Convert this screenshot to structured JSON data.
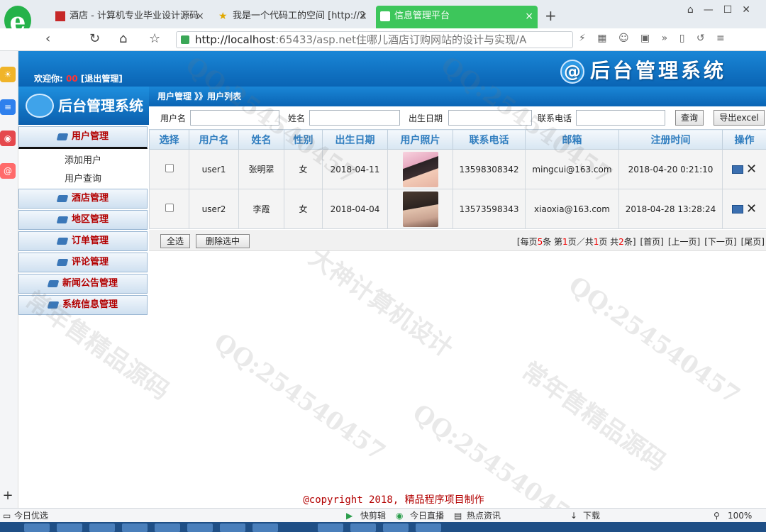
{
  "browser": {
    "logo": "e",
    "tabs": [
      {
        "title": "酒店 - 计算机专业毕业设计源码",
        "close": "×"
      },
      {
        "title": "我是一个代码工的空间 [http://2",
        "close": "×"
      },
      {
        "title": "信息管理平台",
        "close": "×"
      }
    ],
    "new_tab": "+",
    "url_host": "http://localhost",
    "url_rest": ":65433/asp.net住哪儿酒店订购网站的设计与实现/A",
    "status_left": "今日优选",
    "status_items": [
      "快剪辑",
      "今日直播",
      "热点资讯",
      "下载"
    ],
    "zoom": "100%"
  },
  "header": {
    "welcome_label": "欢迎你:",
    "username": "00",
    "logout": "[退出管理]",
    "brand": "后台管理系统",
    "brand_at": "@"
  },
  "sidebar": {
    "title": "后台管理系统",
    "menus": [
      {
        "label": "用户管理"
      },
      {
        "label": "酒店管理"
      },
      {
        "label": "地区管理"
      },
      {
        "label": "订单管理"
      },
      {
        "label": "评论管理"
      },
      {
        "label": "新闻公告管理"
      },
      {
        "label": "系统信息管理"
      }
    ],
    "subitems": [
      "添加用户",
      "用户查询"
    ]
  },
  "breadcrumb": "用户管理 》》用户列表",
  "search": {
    "username_label": "用户名",
    "name_label": "姓名",
    "birth_label": "出生日期",
    "phone_label": "联系电话",
    "query_button": "查询",
    "export_button": "导出excel"
  },
  "table": {
    "headers": [
      "选择",
      "用户名",
      "姓名",
      "性别",
      "出生日期",
      "用户照片",
      "联系电话",
      "邮箱",
      "注册时间",
      "操作"
    ],
    "rows": [
      {
        "username": "user1",
        "name": "张明翠",
        "gender": "女",
        "birth": "2018-04-11",
        "phone": "13598308342",
        "email": "mingcui@163.com",
        "registered": "2018-04-20 0:21:10"
      },
      {
        "username": "user2",
        "name": "李霞",
        "gender": "女",
        "birth": "2018-04-04",
        "phone": "13573598343",
        "email": "xiaoxia@163.com",
        "registered": "2018-04-28 13:28:24"
      }
    ],
    "delete_glyph": "✕"
  },
  "footer": {
    "select_all": "全选",
    "delete_selected": "删除选中",
    "pager_prefix": "[每页",
    "per_page": "5",
    "pager_mid1": "条 第",
    "current_page": "1",
    "pager_mid2": "页／共",
    "total_pages": "1",
    "pager_mid3": "页 共",
    "total_records": "2",
    "pager_suffix": "条]",
    "first": "[首页]",
    "prev": "[上一页]",
    "next": "[下一页]",
    "last": "[尾页]"
  },
  "copyright": "@copyright 2018, 精品程序项目制作",
  "watermark": {
    "qq": "QQ:254540457",
    "phrase1": "大神计算机设计",
    "phrase2": "常年售精品源码"
  }
}
